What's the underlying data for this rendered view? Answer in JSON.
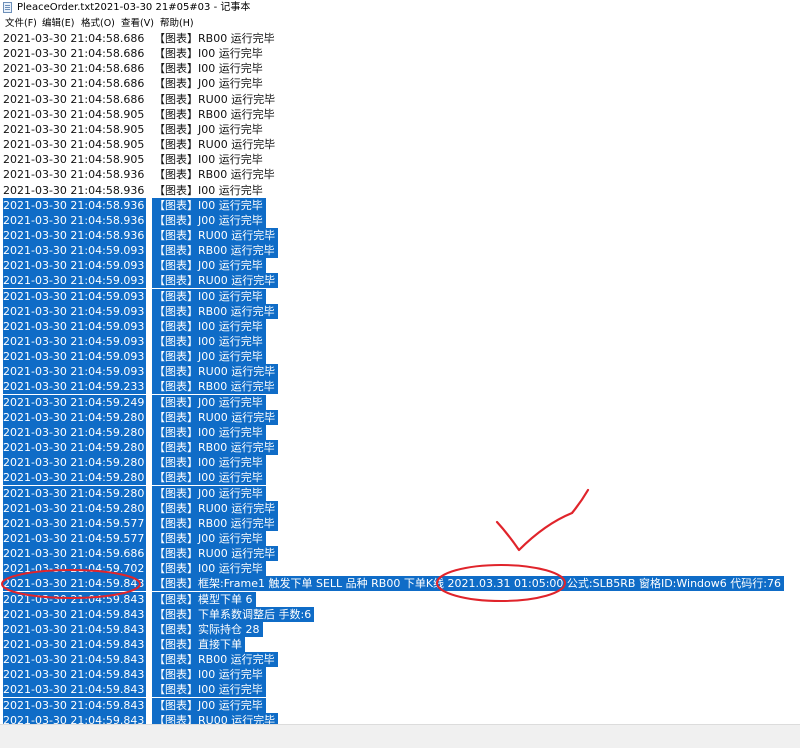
{
  "window": {
    "title": "PleaceOrder.txt2021-03-30 21#05#03 - 记事本"
  },
  "menu": [
    {
      "label": "文件(F)"
    },
    {
      "label": "编辑(E)"
    },
    {
      "label": "格式(O)"
    },
    {
      "label": "查看(V)"
    },
    {
      "label": "帮助(H)"
    }
  ],
  "lines": [
    {
      "ts": "2021-03-30 21:04:58.686",
      "msg": "【图表】RB00 运行完毕",
      "selected": false
    },
    {
      "ts": "2021-03-30 21:04:58.686",
      "msg": "【图表】I00 运行完毕",
      "selected": false
    },
    {
      "ts": "2021-03-30 21:04:58.686",
      "msg": "【图表】I00 运行完毕",
      "selected": false
    },
    {
      "ts": "2021-03-30 21:04:58.686",
      "msg": "【图表】J00 运行完毕",
      "selected": false
    },
    {
      "ts": "2021-03-30 21:04:58.686",
      "msg": "【图表】RU00 运行完毕",
      "selected": false
    },
    {
      "ts": "2021-03-30 21:04:58.905",
      "msg": "【图表】RB00 运行完毕",
      "selected": false
    },
    {
      "ts": "2021-03-30 21:04:58.905",
      "msg": "【图表】J00 运行完毕",
      "selected": false
    },
    {
      "ts": "2021-03-30 21:04:58.905",
      "msg": "【图表】RU00 运行完毕",
      "selected": false
    },
    {
      "ts": "2021-03-30 21:04:58.905",
      "msg": "【图表】I00 运行完毕",
      "selected": false
    },
    {
      "ts": "2021-03-30 21:04:58.936",
      "msg": "【图表】RB00 运行完毕",
      "selected": false
    },
    {
      "ts": "2021-03-30 21:04:58.936",
      "msg": "【图表】I00 运行完毕",
      "selected": false
    },
    {
      "ts": "2021-03-30 21:04:58.936",
      "msg": "【图表】I00 运行完毕",
      "selected": true
    },
    {
      "ts": "2021-03-30 21:04:58.936",
      "msg": "【图表】J00 运行完毕",
      "selected": true
    },
    {
      "ts": "2021-03-30 21:04:58.936",
      "msg": "【图表】RU00 运行完毕",
      "selected": true
    },
    {
      "ts": "2021-03-30 21:04:59.093",
      "msg": "【图表】RB00 运行完毕",
      "selected": true
    },
    {
      "ts": "2021-03-30 21:04:59.093",
      "msg": "【图表】J00 运行完毕",
      "selected": true
    },
    {
      "ts": "2021-03-30 21:04:59.093",
      "msg": "【图表】RU00 运行完毕",
      "selected": true
    },
    {
      "ts": "2021-03-30 21:04:59.093",
      "msg": "【图表】I00 运行完毕",
      "selected": true
    },
    {
      "ts": "2021-03-30 21:04:59.093",
      "msg": "【图表】RB00 运行完毕",
      "selected": true
    },
    {
      "ts": "2021-03-30 21:04:59.093",
      "msg": "【图表】I00 运行完毕",
      "selected": true
    },
    {
      "ts": "2021-03-30 21:04:59.093",
      "msg": "【图表】I00 运行完毕",
      "selected": true
    },
    {
      "ts": "2021-03-30 21:04:59.093",
      "msg": "【图表】J00 运行完毕",
      "selected": true
    },
    {
      "ts": "2021-03-30 21:04:59.093",
      "msg": "【图表】RU00 运行完毕",
      "selected": true
    },
    {
      "ts": "2021-03-30 21:04:59.233",
      "msg": "【图表】RB00 运行完毕",
      "selected": true
    },
    {
      "ts": "2021-03-30 21:04:59.249",
      "msg": "【图表】J00 运行完毕",
      "selected": true
    },
    {
      "ts": "2021-03-30 21:04:59.280",
      "msg": "【图表】RU00 运行完毕",
      "selected": true
    },
    {
      "ts": "2021-03-30 21:04:59.280",
      "msg": "【图表】I00 运行完毕",
      "selected": true
    },
    {
      "ts": "2021-03-30 21:04:59.280",
      "msg": "【图表】RB00 运行完毕",
      "selected": true
    },
    {
      "ts": "2021-03-30 21:04:59.280",
      "msg": "【图表】I00 运行完毕",
      "selected": true
    },
    {
      "ts": "2021-03-30 21:04:59.280",
      "msg": "【图表】I00 运行完毕",
      "selected": true
    },
    {
      "ts": "2021-03-30 21:04:59.280",
      "msg": "【图表】J00 运行完毕",
      "selected": true
    },
    {
      "ts": "2021-03-30 21:04:59.280",
      "msg": "【图表】RU00 运行完毕",
      "selected": true
    },
    {
      "ts": "2021-03-30 21:04:59.577",
      "msg": "【图表】RB00 运行完毕",
      "selected": true
    },
    {
      "ts": "2021-03-30 21:04:59.577",
      "msg": "【图表】J00 运行完毕",
      "selected": true
    },
    {
      "ts": "2021-03-30 21:04:59.686",
      "msg": "【图表】RU00 运行完毕",
      "selected": true
    },
    {
      "ts": "2021-03-30 21:04:59.702",
      "msg": "【图表】I00 运行完毕",
      "selected": true
    },
    {
      "ts": "2021-03-30 21:04:59.843",
      "msg": "【图表】框架:Frame1 触发下单 SELL 品种 RB00 下单K线 2021.03.31 01:05:00 公式:SLB5RB 窗格ID:Window6 代码行:76",
      "selected": true
    },
    {
      "ts": "2021-03-30 21:04:59.843",
      "msg": "【图表】模型下单 6",
      "selected": true
    },
    {
      "ts": "2021-03-30 21:04:59.843",
      "msg": "【图表】下单系数调整后 手数:6",
      "selected": true
    },
    {
      "ts": "2021-03-30 21:04:59.843",
      "msg": "【图表】实际持仓 28",
      "selected": true
    },
    {
      "ts": "2021-03-30 21:04:59.843",
      "msg": "【图表】直接下单",
      "selected": true
    },
    {
      "ts": "2021-03-30 21:04:59.843",
      "msg": "【图表】RB00 运行完毕",
      "selected": true
    },
    {
      "ts": "2021-03-30 21:04:59.843",
      "msg": "【图表】I00 运行完毕",
      "selected": true
    },
    {
      "ts": "2021-03-30 21:04:59.843",
      "msg": "【图表】I00 运行完毕",
      "selected": true
    },
    {
      "ts": "2021-03-30 21:04:59.843",
      "msg": "【图表】J00 运行完毕",
      "selected": true
    },
    {
      "ts": "2021-03-30 21:04:59.843",
      "msg": "【图表】RU00 运行完毕",
      "selected": true
    }
  ],
  "colors": {
    "selection": "#0f6cc7",
    "annotation": "#e0242b"
  },
  "annotations": [
    "circle-timestamp",
    "circle-kline-time",
    "checkmark"
  ]
}
